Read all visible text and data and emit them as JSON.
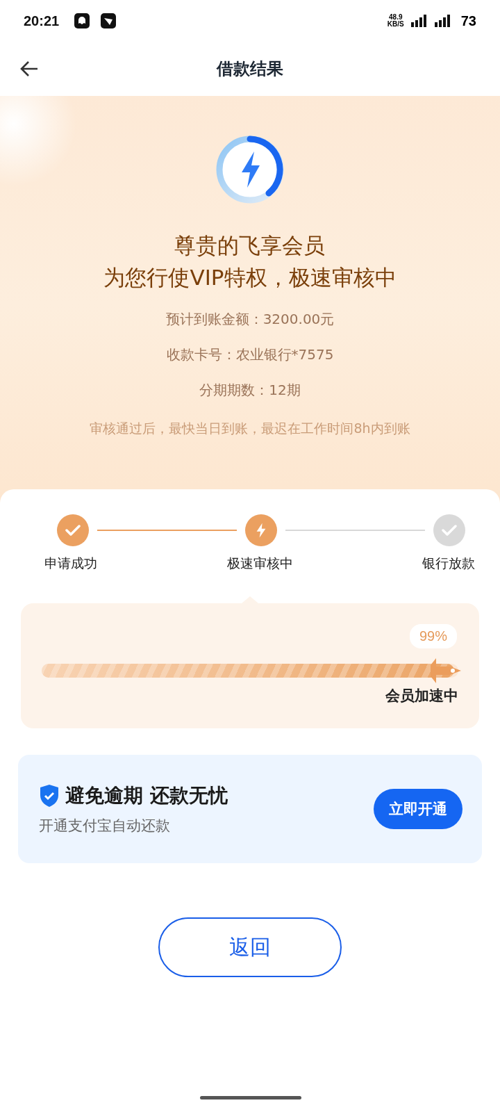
{
  "status_bar": {
    "time": "20:21",
    "net_speed": "48.9",
    "net_unit": "KB/S",
    "battery": "73"
  },
  "header": {
    "title": "借款结果"
  },
  "hero": {
    "headline": "尊贵的飞享会员",
    "subline": "为您行使VIP特权，极速审核中",
    "details": [
      "预计到账金额：3200.00元",
      "收款卡号：农业银行*7575",
      "分期期数：12期"
    ],
    "note": "审核通过后，最快当日到账，最迟在工作时间8h内到账"
  },
  "steps": [
    {
      "label": "申请成功",
      "completed": true,
      "current": false
    },
    {
      "label": "极速审核中",
      "completed": false,
      "current": true
    },
    {
      "label": "银行放款",
      "completed": false,
      "current": false
    }
  ],
  "progress": {
    "level": 0.99,
    "reading": "99%",
    "caption": "会员加速中"
  },
  "promo": {
    "title": "避免逾期 还款无忧",
    "subtitle": "开通支付宝自动还款",
    "button": "立即开通"
  },
  "back_button": "返回"
}
